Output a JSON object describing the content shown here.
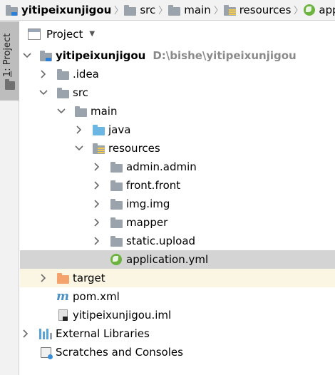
{
  "breadcrumb": [
    {
      "label": "yitipeixunjigou",
      "icon": "module-folder-icon",
      "bold": true
    },
    {
      "label": "src",
      "icon": "folder-icon",
      "bold": false
    },
    {
      "label": "main",
      "icon": "folder-icon",
      "bold": false
    },
    {
      "label": "resources",
      "icon": "resources-folder-icon",
      "bold": false
    },
    {
      "label": "appli",
      "icon": "spring-leaf-icon",
      "bold": false
    }
  ],
  "toolstrip": {
    "project_label_prefix": "1",
    "project_label_rest": ": Project"
  },
  "panel": {
    "title": "Project",
    "dropdown_glyph": "▼"
  },
  "tree": {
    "root": {
      "label": "yitipeixunjigou",
      "path": "D:\\bishe\\yitipeixunjigou"
    },
    "idea": {
      "label": ".idea"
    },
    "src": {
      "label": "src"
    },
    "main": {
      "label": "main"
    },
    "java": {
      "label": "java"
    },
    "resources": {
      "label": "resources"
    },
    "admin": {
      "label": "admin.admin"
    },
    "front": {
      "label": "front.front"
    },
    "img": {
      "label": "img.img"
    },
    "mapper": {
      "label": "mapper"
    },
    "static_upload": {
      "label": "static.upload"
    },
    "application": {
      "label": "application.yml"
    },
    "target": {
      "label": "target"
    },
    "pom": {
      "label": "pom.xml",
      "icon_glyph": "m"
    },
    "iml": {
      "label": "yitipeixunjigou.iml"
    },
    "external": {
      "label": "External Libraries"
    },
    "scratches": {
      "label": "Scratches and Consoles"
    }
  },
  "colors": {
    "selection": "#d4d4d4",
    "excluded_row": "#fbf6e4",
    "folder_grey": "#9aa2ab",
    "folder_blue": "#6bb6e3",
    "folder_orange": "#f3a36b",
    "spring_green": "#6db33f"
  }
}
